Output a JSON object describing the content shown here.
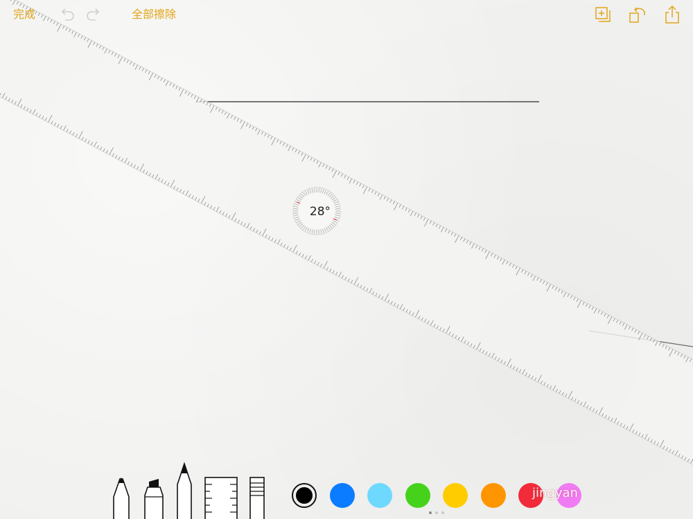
{
  "toolbar": {
    "done_label": "完成",
    "clear_all_label": "全部擦除",
    "undo_icon": "undo-icon",
    "redo_icon": "redo-icon",
    "new_note_icon": "add-page-icon",
    "rotate_icon": "rotate-icon",
    "share_icon": "share-icon"
  },
  "ruler": {
    "angle_label": "28°"
  },
  "tools": [
    {
      "name": "pen"
    },
    {
      "name": "marker"
    },
    {
      "name": "pencil"
    },
    {
      "name": "ruler"
    },
    {
      "name": "eraser"
    }
  ],
  "colors": [
    {
      "name": "black",
      "hex": "#000000",
      "selected": true
    },
    {
      "name": "blue",
      "hex": "#0b7cff"
    },
    {
      "name": "light-blue",
      "hex": "#6fd8ff"
    },
    {
      "name": "green",
      "hex": "#45d21b"
    },
    {
      "name": "yellow",
      "hex": "#ffcc00"
    },
    {
      "name": "orange",
      "hex": "#ff9500"
    },
    {
      "name": "red",
      "hex": "#f12b3a"
    },
    {
      "name": "pink",
      "hex": "#f07bf3"
    }
  ],
  "accent_color": "#e2a51b",
  "pages": {
    "count": 3,
    "current": 1
  },
  "watermark": "jingyan"
}
